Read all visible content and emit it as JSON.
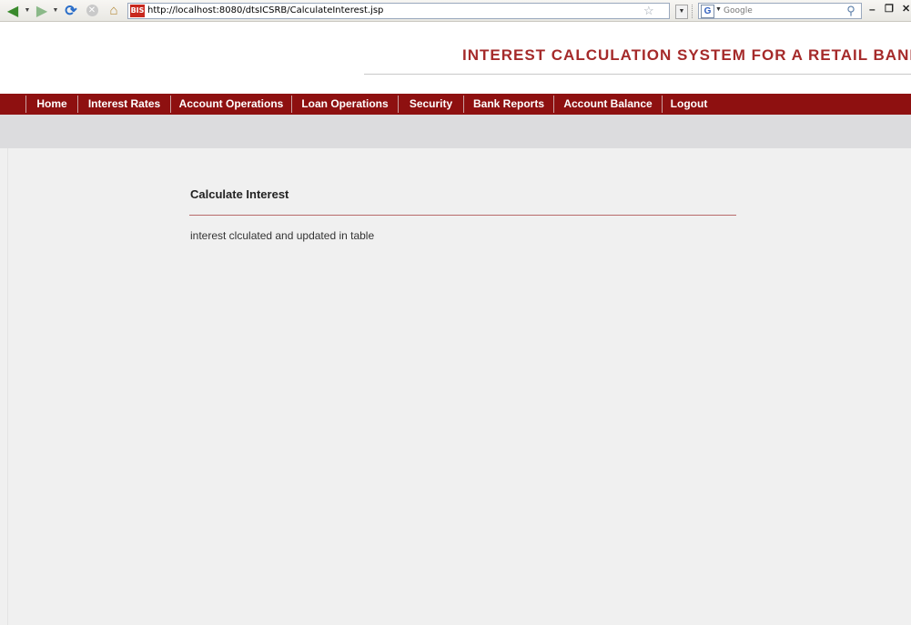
{
  "browser": {
    "url": "http://localhost:8080/dtsICSRB/CalculateInterest.jsp",
    "favicon_text": "BIS",
    "search_placeholder": "Google",
    "search_engine_glyph": "G",
    "icons": [
      "back-icon",
      "forward-icon",
      "reload-icon",
      "stop-icon",
      "home-icon",
      "bookmark-star-icon",
      "search-magnify-icon",
      "minimize-icon",
      "restore-icon",
      "close-icon"
    ]
  },
  "header": {
    "title": "INTEREST CALCULATION SYSTEM FOR A RETAIL BANK",
    "title_color": "#a52a2a"
  },
  "nav": {
    "background": "#8e1010",
    "items": [
      {
        "label": "Home"
      },
      {
        "label": "Interest Rates"
      },
      {
        "label": "Account Operations"
      },
      {
        "label": "Loan Operations"
      },
      {
        "label": "Security"
      },
      {
        "label": "Bank Reports"
      },
      {
        "label": "Account Balance"
      },
      {
        "label": "Logout"
      }
    ]
  },
  "main": {
    "heading": "Calculate Interest",
    "message": "interest clculated and updated in table"
  }
}
